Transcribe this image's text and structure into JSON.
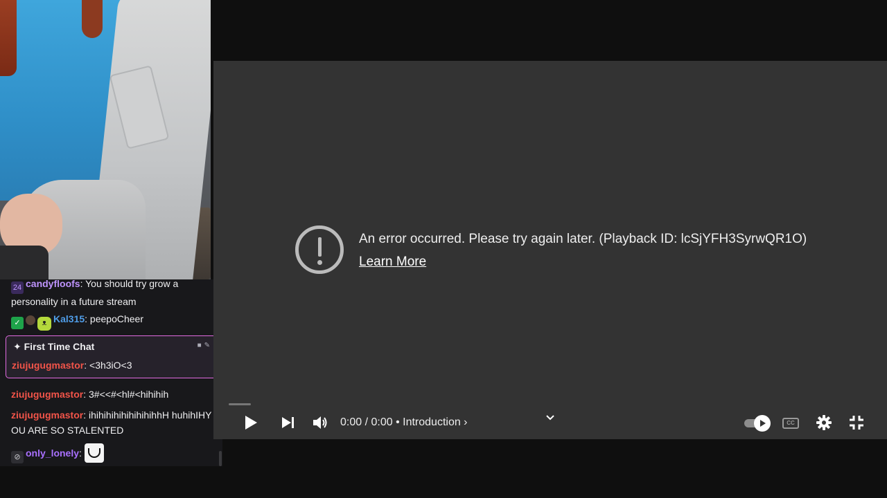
{
  "chat": {
    "messages": [
      {
        "user": "candyfloofs",
        "sep": ":",
        "text": " You should try grow a personality in a future stream",
        "user_color": "#bf94ff"
      },
      {
        "user": "Kal315",
        "sep": ":",
        "text": " peepoCheer",
        "user_color": "#4f9de8"
      },
      {
        "user": "ziujugugmastor",
        "sep": ":",
        "text": " 3#<<#<hl#<hihihih",
        "user_color": "#f25449"
      },
      {
        "user": "ziujugugmastor",
        "sep": ":",
        "text": " ihihihihihihihihihhH huhihIHY OU ARE SO STALENTED",
        "user_color": "#f25449"
      },
      {
        "user": "only_lonely",
        "sep": ":",
        "text": "",
        "user_color": "#a970ff"
      }
    ],
    "first_time_chat": {
      "header": "First Time Chat",
      "user": "ziujugugmastor",
      "sep": ":",
      "text": " <3h3iO<3",
      "user_color": "#f25449",
      "accent": "#e36be2"
    },
    "badge_text": "24"
  },
  "player": {
    "error_text": "An error occurred. Please try again later. (Playback ID: lcSjYFH3SyrwQR1O)",
    "learn_more": "Learn More",
    "time_current": "0:00",
    "time_sep": " / ",
    "time_total": "0:00",
    "chapter_bullet": " • ",
    "chapter": "Introduction ›",
    "cc_label": "CC",
    "icons": [
      "play-icon",
      "next-icon",
      "volume-icon",
      "chevron-down-icon",
      "autoplay-toggle",
      "captions-icon",
      "settings-icon",
      "exit-fullscreen-icon"
    ]
  }
}
